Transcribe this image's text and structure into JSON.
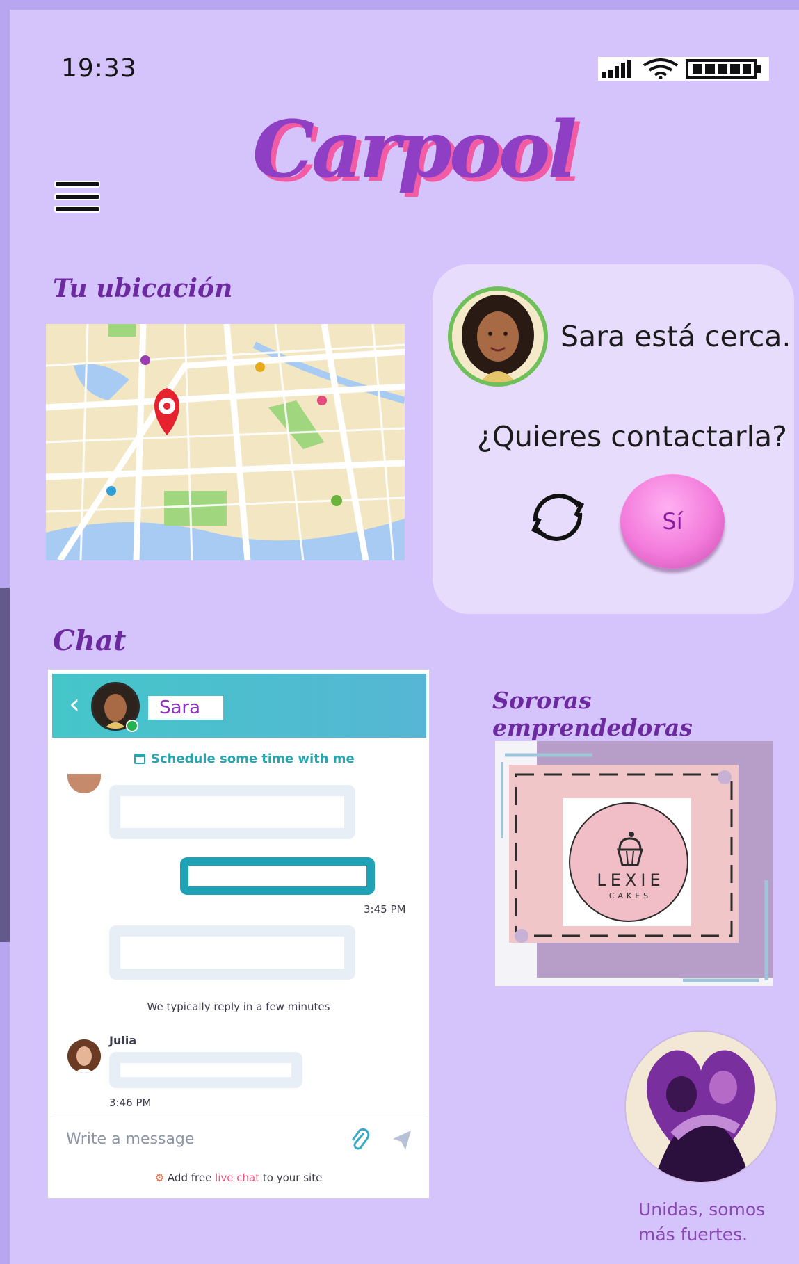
{
  "status_bar": {
    "time": "19:33"
  },
  "app": {
    "title": "Carpool"
  },
  "location": {
    "heading": "Tu ubicación"
  },
  "contact_card": {
    "near_text": "Sara está cerca.",
    "question": "¿Quieres contactarla?",
    "yes_label": "Sí"
  },
  "chat": {
    "heading": "Chat",
    "contact_name": "Sara",
    "schedule_link": "Schedule some time with me",
    "times": [
      "3:45 PM",
      "3:46 PM"
    ],
    "reply_note": "We typically reply in a few minutes",
    "agent_name": "Julia",
    "input_placeholder": "Write a message",
    "promo_prefix": "Add free ",
    "promo_link": "live chat",
    "promo_suffix": " to your site"
  },
  "sororas": {
    "heading": "Sororas emprendedoras",
    "logo_name": "LEXIE",
    "logo_sub": "CAKES"
  },
  "unidas": {
    "caption_line1": "Unidas, somos",
    "caption_line2": "más fuertes."
  },
  "icons": [
    "signal-icon",
    "wifi-icon",
    "battery-icon",
    "hamburger-menu-icon",
    "map-pin-icon",
    "refresh-icon",
    "calendar-icon",
    "paperclip-icon",
    "send-icon",
    "chevron-left-icon",
    "cupcake-icon"
  ],
  "colors": {
    "background": "#d5c3fb",
    "card": "#e8dcfd",
    "accent_purple": "#8e3fc4",
    "accent_pink": "#f25ca5",
    "chat_header": "#44c6c9"
  }
}
